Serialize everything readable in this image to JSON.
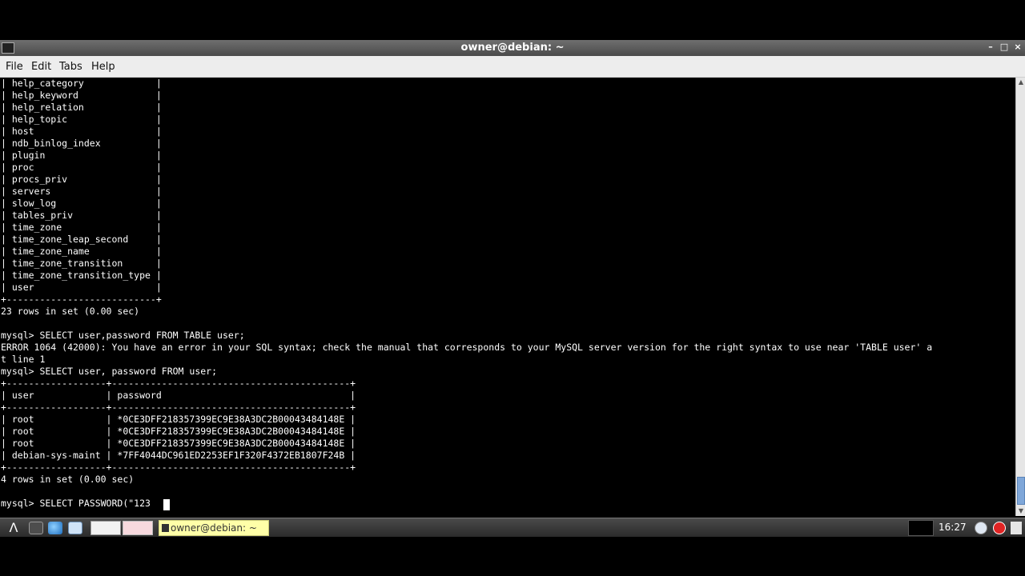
{
  "window": {
    "title": "owner@debian: ~"
  },
  "menu": {
    "file": "File",
    "edit": "Edit",
    "tabs": "Tabs",
    "help": "Help"
  },
  "terminal": {
    "lines": [
      "| help_category             |",
      "| help_keyword              |",
      "| help_relation             |",
      "| help_topic                |",
      "| host                      |",
      "| ndb_binlog_index          |",
      "| plugin                    |",
      "| proc                      |",
      "| procs_priv                |",
      "| servers                   |",
      "| slow_log                  |",
      "| tables_priv               |",
      "| time_zone                 |",
      "| time_zone_leap_second     |",
      "| time_zone_name            |",
      "| time_zone_transition      |",
      "| time_zone_transition_type |",
      "| user                      |",
      "+---------------------------+",
      "23 rows in set (0.00 sec)",
      "",
      "mysql> SELECT user,password FROM TABLE user;",
      "ERROR 1064 (42000): You have an error in your SQL syntax; check the manual that corresponds to your MySQL server version for the right syntax to use near 'TABLE user' a",
      "t line 1",
      "mysql> SELECT user, password FROM user;",
      "+------------------+-------------------------------------------+",
      "| user             | password                                  |",
      "+------------------+-------------------------------------------+",
      "| root             | *0CE3DFF218357399EC9E38A3DC2B00043484148E |",
      "| root             | *0CE3DFF218357399EC9E38A3DC2B00043484148E |",
      "| root             | *0CE3DFF218357399EC9E38A3DC2B00043484148E |",
      "| debian-sys-maint | *7FF4044DC961ED2253EF1F320F4372EB1807F24B |",
      "+------------------+-------------------------------------------+",
      "4 rows in set (0.00 sec)",
      "",
      "mysql> SELECT PASSWORD(\"123"
    ]
  },
  "taskbar": {
    "active_task_label": "owner@debian: ~",
    "clock": "16:27"
  },
  "colors": {
    "terminal_bg": "#000000",
    "terminal_fg": "#ffffff",
    "active_task_bg": "#ffffa8"
  }
}
